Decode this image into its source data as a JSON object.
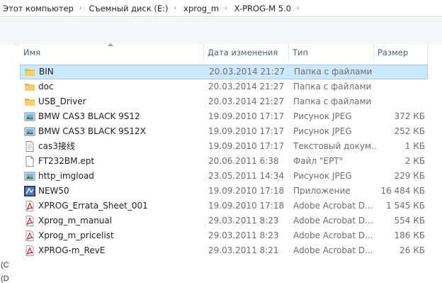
{
  "breadcrumb": [
    "Этот компьютер",
    "Съемный диск (E:)",
    "xprog_m",
    "X-PROG-M 5.0"
  ],
  "breadcrumb_separator": "›",
  "columns": {
    "name": "Имя",
    "date": "Дата изменения",
    "type": "Тип",
    "size": "Размер"
  },
  "nav_fragments": [
    "(C",
    "(D"
  ],
  "selected_color": "#cce8ff",
  "files": [
    {
      "name": "BIN",
      "date": "20.03.2014 21:27",
      "type": "Папка с файлами",
      "size": "",
      "icon": "folder-icon",
      "selected": true
    },
    {
      "name": "doc",
      "date": "20.03.2014 21:27",
      "type": "Папка с файлами",
      "size": "",
      "icon": "folder-icon"
    },
    {
      "name": "USB_Driver",
      "date": "20.03.2014 21:27",
      "type": "Папка с файлами",
      "size": "",
      "icon": "folder-icon"
    },
    {
      "name": "BMW CAS3 BLACK 9S12",
      "date": "19.09.2010 17:17",
      "type": "Рисунок JPEG",
      "size": "372 КБ",
      "icon": "image-icon"
    },
    {
      "name": "BMW CAS3 BLACK 9S12X",
      "date": "19.09.2010 17:17",
      "type": "Рисунок JPEG",
      "size": "252 КБ",
      "icon": "image-icon"
    },
    {
      "name": "cas3接线",
      "date": "19.09.2010 17:17",
      "type": "Текстовый докум...",
      "size": "1 КБ",
      "icon": "text-file-icon"
    },
    {
      "name": "FT232BM.ept",
      "date": "20.06.2011 6:38",
      "type": "Файл \"EPT\"",
      "size": "2 КБ",
      "icon": "blank-file-icon"
    },
    {
      "name": "http_imgload",
      "date": "23.05.2011 14:34",
      "type": "Рисунок JPEG",
      "size": "229 КБ",
      "icon": "image-icon"
    },
    {
      "name": "NEW50",
      "date": "19.09.2010 17:18",
      "type": "Приложение",
      "size": "16 484 КБ",
      "icon": "application-icon"
    },
    {
      "name": "XPROG_Errata_Sheet_001",
      "date": "19.09.2010 17:18",
      "type": "Adobe Acrobat D...",
      "size": "1 545 КБ",
      "icon": "pdf-icon"
    },
    {
      "name": "Xprog_m_manual",
      "date": "29.03.2011 8:23",
      "type": "Adobe Acrobat D...",
      "size": "554 КБ",
      "icon": "pdf-icon"
    },
    {
      "name": "Xprog_m_pricelist",
      "date": "29.03.2011 8:23",
      "type": "Adobe Acrobat D...",
      "size": "186 КБ",
      "icon": "pdf-icon"
    },
    {
      "name": "XPROG-m_RevE",
      "date": "29.03.2011 8:21",
      "type": "Adobe Acrobat D...",
      "size": "26 КБ",
      "icon": "pdf-icon"
    }
  ]
}
